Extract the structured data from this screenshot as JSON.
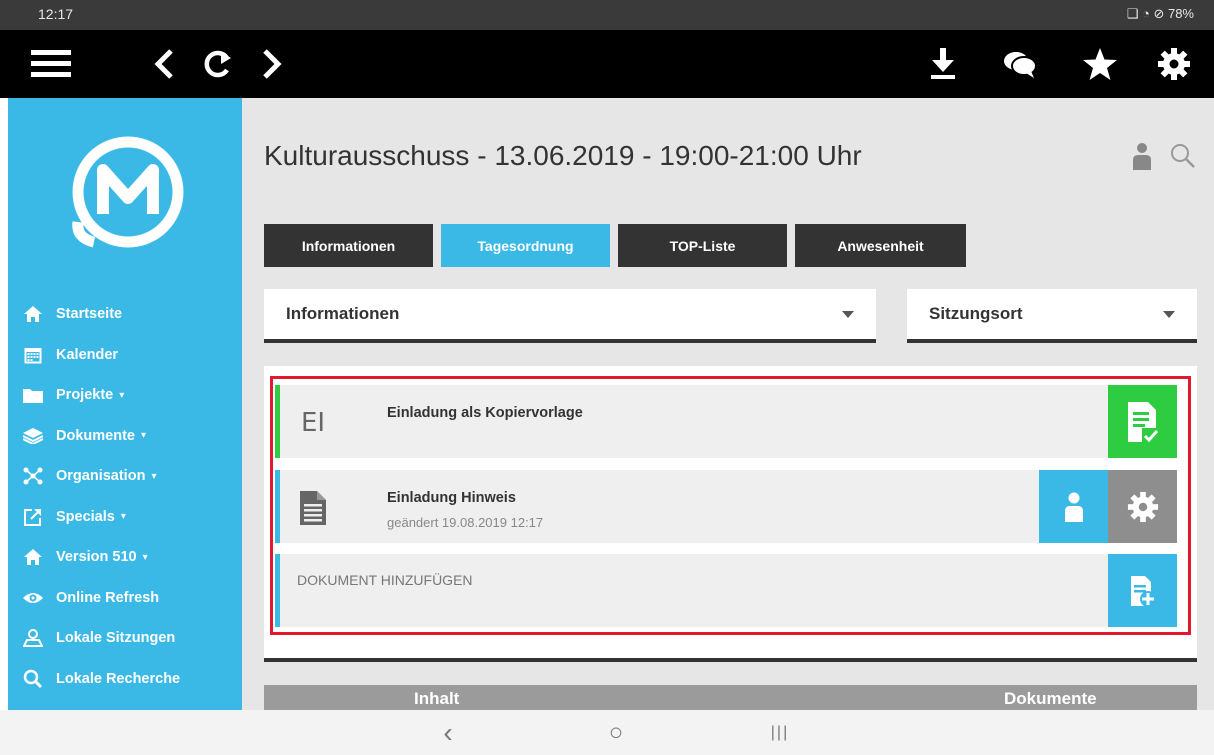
{
  "status_bar": {
    "time": "12:17",
    "icons": "❑ ◔ ⊘ 78%",
    "battery_text": "78%"
  },
  "toolbar": {
    "icons": [
      "menu-icon",
      "back-icon",
      "refresh-icon",
      "forward-icon",
      "download-icon",
      "chat-icon",
      "star-icon",
      "gear-icon"
    ]
  },
  "sidebar": {
    "logo_icon": "m-logo",
    "items": [
      {
        "label": "Startseite",
        "icon": "home-icon",
        "caret": false
      },
      {
        "label": "Kalender",
        "icon": "calendar-icon",
        "caret": false
      },
      {
        "label": "Projekte",
        "icon": "folder-icon",
        "caret": true
      },
      {
        "label": "Dokumente",
        "icon": "layers-icon",
        "caret": true
      },
      {
        "label": "Organisation",
        "icon": "org-icon",
        "caret": true
      },
      {
        "label": "Specials",
        "icon": "external-link-icon",
        "caret": true
      },
      {
        "label": "Version 510",
        "icon": "home-icon",
        "caret": true
      },
      {
        "label": "Online Refresh",
        "icon": "eye-icon",
        "caret": false
      },
      {
        "label": "Lokale Sitzungen",
        "icon": "user-pin-icon",
        "caret": false
      },
      {
        "label": "Lokale Recherche",
        "icon": "search-icon",
        "caret": false
      }
    ],
    "caret_glyph": "▾"
  },
  "main": {
    "title": "Kulturausschuss - 13.06.2019 - 19:00-21:00 Uhr",
    "tabs": [
      {
        "label": "Informationen",
        "active": false
      },
      {
        "label": "Tagesordnung",
        "active": true
      },
      {
        "label": "TOP-Liste",
        "active": false
      },
      {
        "label": "Anwesenheit",
        "active": false
      }
    ],
    "dropdowns": [
      {
        "label": "Informationen"
      },
      {
        "label": "Sitzungsort"
      }
    ],
    "documents": [
      {
        "icon_text": "EI",
        "title": "Einladung als Kopiervorlage",
        "subtitle": "",
        "bar_color": "#2ecc40",
        "actions": [
          "document-check-icon"
        ]
      },
      {
        "icon_text": "",
        "title": "Einladung Hinweis",
        "subtitle": "geändert 19.08.2019 12:17",
        "bar_color": "#3bb9e6",
        "actions": [
          "user-icon",
          "gear-icon"
        ]
      }
    ],
    "add_document_label": "DOKUMENT HINZUFÜGEN",
    "bottom_tabs": [
      "Inhalt",
      "Dokumente"
    ]
  },
  "colors": {
    "accent": "#3bb9e6",
    "green": "#2ecc40",
    "dark": "#333333",
    "highlight_frame": "#e0192e"
  },
  "android_nav": {
    "back": "‹",
    "home": "○",
    "recents": "|||"
  }
}
